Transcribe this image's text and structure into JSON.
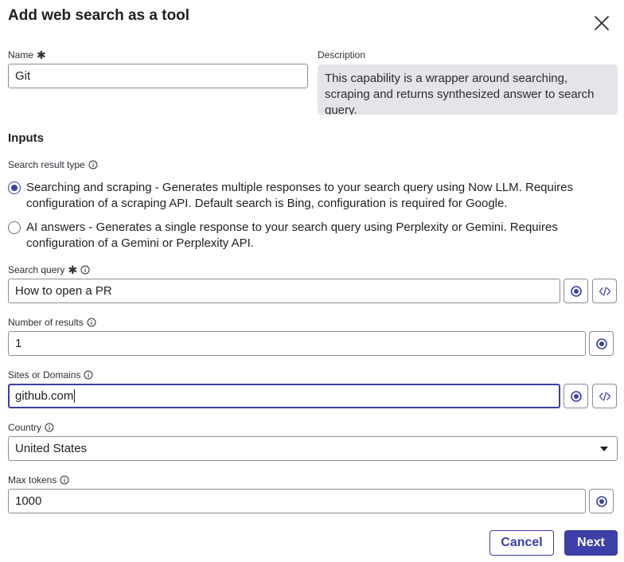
{
  "dialog": {
    "title": "Add web search as a tool"
  },
  "fields": {
    "name": {
      "label": "Name",
      "value": "Git"
    },
    "description": {
      "label": "Description",
      "value": "This capability is a wrapper around searching, scraping and returns synthesized answer to search query."
    }
  },
  "inputs_section": {
    "heading": "Inputs"
  },
  "search_result_type": {
    "label": "Search result type",
    "options": [
      {
        "label": "Searching and scraping - Generates multiple responses to your search query using Now LLM. Requires configuration of a scraping API. Default search is Bing, configuration is required for Google.",
        "selected": true
      },
      {
        "label": "AI answers - Generates a single response to your search query using Perplexity or Gemini. Requires configuration of a Gemini or Perplexity API.",
        "selected": false
      }
    ]
  },
  "search_query": {
    "label": "Search query",
    "value": "How to open a PR"
  },
  "number_of_results": {
    "label": "Number of results",
    "value": "1"
  },
  "sites_or_domains": {
    "label": "Sites or Domains",
    "value": "github.com"
  },
  "country": {
    "label": "Country",
    "value": "United States"
  },
  "max_tokens": {
    "label": "Max tokens",
    "value": "1000"
  },
  "actions": {
    "cancel_label": "Cancel",
    "next_label": "Next"
  },
  "colors": {
    "accent": "#3b3fa7",
    "description_bg": "#e4e5e9",
    "border": "#8a8d96"
  },
  "icons": {
    "close": "close-icon",
    "info": "info-icon",
    "preview": "eye-icon",
    "code": "code-icon",
    "dropdown": "caret-down-icon"
  }
}
